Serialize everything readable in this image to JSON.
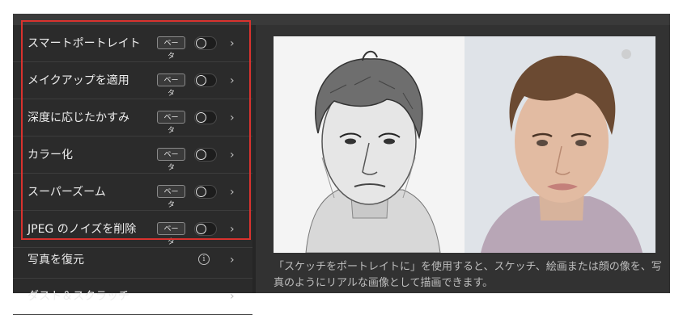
{
  "sidebar": {
    "items": [
      {
        "label": "スマートポートレイト",
        "badge": "ベータ",
        "chevron": "›"
      },
      {
        "label": "メイクアップを適用",
        "badge": "ベータ",
        "chevron": "›"
      },
      {
        "label": "深度に応じたかすみ",
        "badge": "ベータ",
        "chevron": "›"
      },
      {
        "label": "カラー化",
        "badge": "ベータ",
        "chevron": "›"
      },
      {
        "label": "スーパーズーム",
        "badge": "ベータ",
        "chevron": "›"
      },
      {
        "label": "JPEG のノイズを削除",
        "badge": "ベータ",
        "chevron": "›"
      },
      {
        "label": "写真を復元",
        "info": "i",
        "chevron": "›"
      },
      {
        "label": "ダスト＆スクラッチ",
        "chevron": "›"
      }
    ]
  },
  "main": {
    "caption": "「スケッチをポートレイトに」を使用すると、スケッチ、絵画または顔の像を、写真のようにリアルな画像として描画できます。"
  },
  "colors": {
    "highlight": "#d9322e",
    "panel_bg": "#2b2b2b",
    "main_bg": "#323232"
  }
}
